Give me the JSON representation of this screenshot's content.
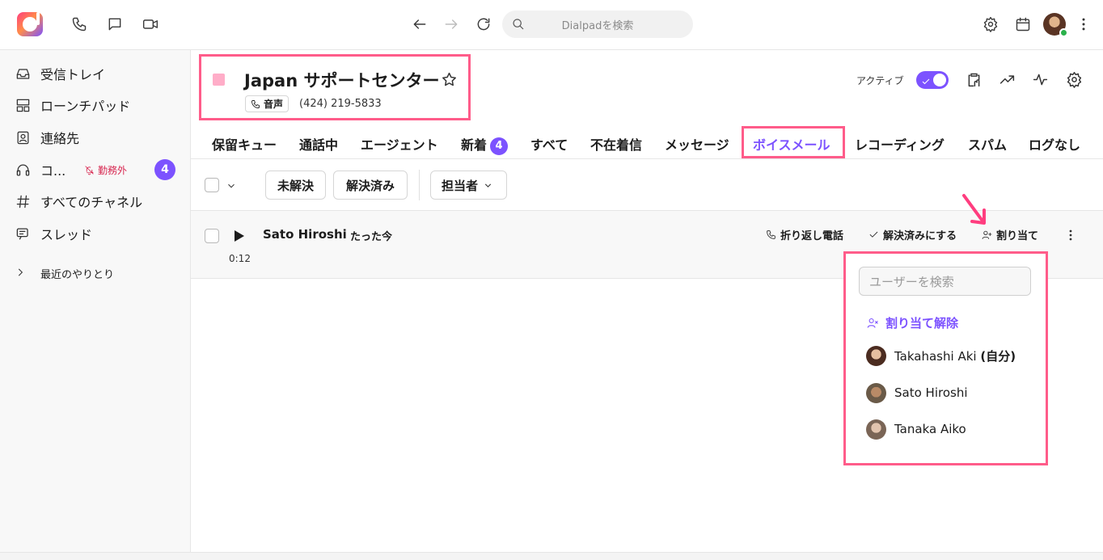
{
  "topbar": {
    "search_placeholder": "Dialpadを検索"
  },
  "sidebar": {
    "items": [
      {
        "label": "受信トレイ",
        "icon": "inbox-icon"
      },
      {
        "label": "ローンチパッド",
        "icon": "launchpad-icon"
      },
      {
        "label": "連絡先",
        "icon": "contacts-icon"
      },
      {
        "label": "コ...",
        "icon": "headset-icon",
        "status": "勤務外",
        "count": "4"
      },
      {
        "label": "すべてのチャネル",
        "icon": "hash-icon"
      },
      {
        "label": "スレッド",
        "icon": "threads-icon"
      }
    ],
    "recent_label": "最近のやりとり"
  },
  "header": {
    "title": "Japan サポートセンター",
    "voice_tag": "音声",
    "phone_number": "(424) 219-5833",
    "active_label": "アクティブ",
    "active": true,
    "accent_color": "#7c52ff",
    "highlight_color": "#ff5c8a"
  },
  "tabs": [
    {
      "label": "保留キュー"
    },
    {
      "label": "通話中"
    },
    {
      "label": "エージェント"
    },
    {
      "label": "新着",
      "badge": "4"
    },
    {
      "label": "すべて"
    },
    {
      "label": "不在着信"
    },
    {
      "label": "メッセージ"
    },
    {
      "label": "ボイスメール",
      "active": true
    },
    {
      "label": "レコーディング"
    },
    {
      "label": "スパム"
    },
    {
      "label": "ログなし"
    }
  ],
  "filters": {
    "unresolved": "未解決",
    "resolved": "解決済み",
    "assignee": "担当者"
  },
  "voicemail": {
    "caller": "Sato Hiroshi",
    "time": "たった今",
    "duration": "0:12",
    "callback": "折り返し電話",
    "mark_resolved": "解決済みにする",
    "assign": "割り当て"
  },
  "assign_menu": {
    "search_placeholder": "ユーザーを検索",
    "unassign": "割り当て解除",
    "users": [
      {
        "name": "Takahashi Aki",
        "suffix": "(自分)"
      },
      {
        "name": "Sato Hiroshi",
        "suffix": ""
      },
      {
        "name": "Tanaka Aiko",
        "suffix": ""
      }
    ]
  }
}
